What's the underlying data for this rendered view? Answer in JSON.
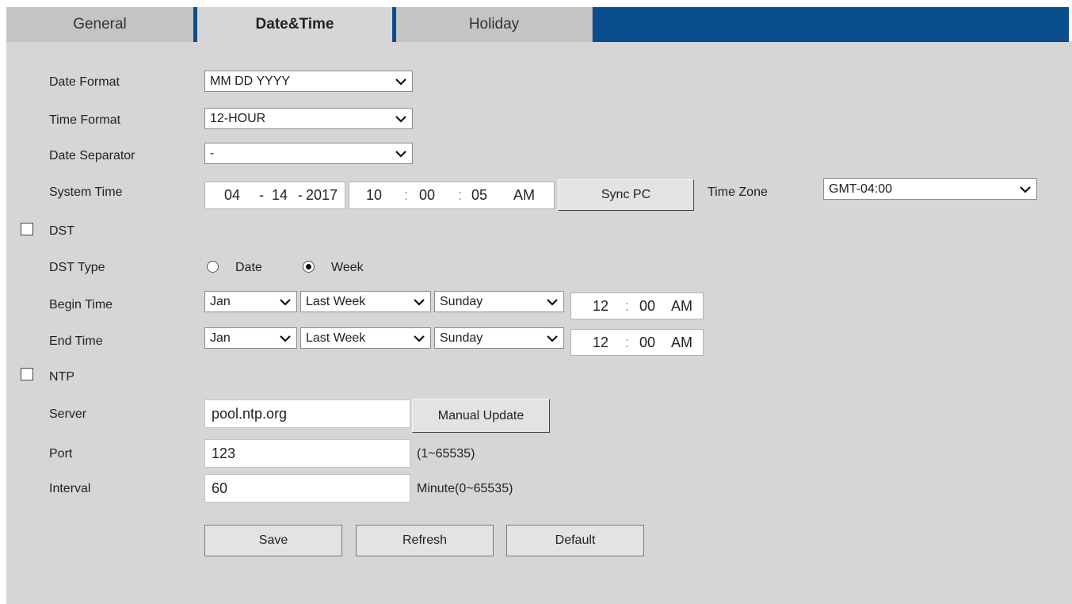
{
  "tabs": [
    {
      "label": "General",
      "active": false
    },
    {
      "label": "Date&Time",
      "active": true
    },
    {
      "label": "Holiday",
      "active": false
    }
  ],
  "labels": {
    "date_format": "Date Format",
    "time_format": "Time Format",
    "date_separator": "Date Separator",
    "system_time": "System Time",
    "time_zone": "Time Zone",
    "dst": "DST",
    "dst_type": "DST Type",
    "begin_time": "Begin Time",
    "end_time": "End Time",
    "ntp": "NTP",
    "server": "Server",
    "port": "Port",
    "interval": "Interval"
  },
  "date_format": "MM DD YYYY",
  "time_format": "12-HOUR",
  "date_separator": "-",
  "system_time": {
    "month": "04",
    "sep1": "-",
    "day": "14",
    "sep2": "-",
    "year": "2017",
    "hour": "10",
    "colon1": ":",
    "minute": "00",
    "colon2": ":",
    "second": "05",
    "ampm": "AM"
  },
  "sync_pc": "Sync PC",
  "time_zone": "GMT-04:00",
  "dst_enabled": false,
  "dst_type": {
    "option_date": "Date",
    "option_week": "Week",
    "selected": "Week"
  },
  "begin": {
    "month": "Jan",
    "week": "Last Week",
    "day": "Sunday",
    "hour": "12",
    "colon": ":",
    "minute": "00",
    "ampm": "AM"
  },
  "end": {
    "month": "Jan",
    "week": "Last Week",
    "day": "Sunday",
    "hour": "12",
    "colon": ":",
    "minute": "00",
    "ampm": "AM"
  },
  "ntp_enabled": false,
  "server": "pool.ntp.org",
  "manual_update": "Manual Update",
  "port": "123",
  "port_hint": "(1~65535)",
  "interval": "60",
  "interval_hint": "Minute(0~65535)",
  "buttons": {
    "save": "Save",
    "refresh": "Refresh",
    "default": "Default"
  },
  "colors": {
    "tab_bar": "#0a4d8c",
    "panel": "#d6d6d6"
  },
  "icons": {
    "dropdown": "chevron-down-icon"
  }
}
